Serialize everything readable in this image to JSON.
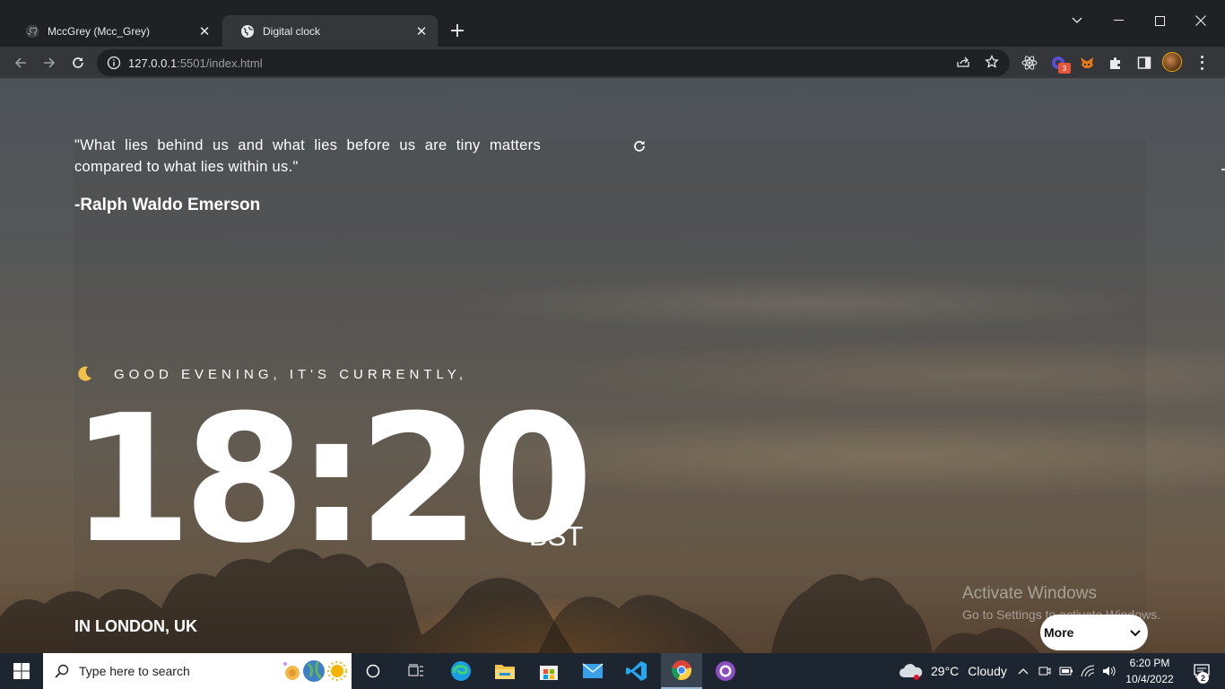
{
  "browser": {
    "tabs": [
      {
        "title": "MccGrey (Mcc_Grey)",
        "icon": "github-icon",
        "active": false
      },
      {
        "title": "Digital clock",
        "icon": "globe-icon",
        "active": true
      }
    ],
    "url_host": "127.0.0.1",
    "url_path": ":5501/index.html"
  },
  "page": {
    "quote": "\"What lies behind us and what lies before us are tiny matters compared to what lies within us.\"",
    "author": "-Ralph Waldo Emerson",
    "greeting": "GOOD EVENING, IT'S CURRENTLY,",
    "time": "18:20",
    "timezone": "BST",
    "location": "IN LONDON, UK",
    "more_button": "More"
  },
  "watermark": {
    "title": "Activate Windows",
    "subtitle": "Go to Settings to activate Windows."
  },
  "taskbar": {
    "search_placeholder": "Type here to search",
    "weather_temp": "29°C",
    "weather_text": "Cloudy",
    "time": "6:20 PM",
    "date": "10/4/2022",
    "notification_count": "2"
  },
  "colors": {
    "accent_badge": "#e8543a",
    "taskbar_bg": "#1c2530"
  }
}
